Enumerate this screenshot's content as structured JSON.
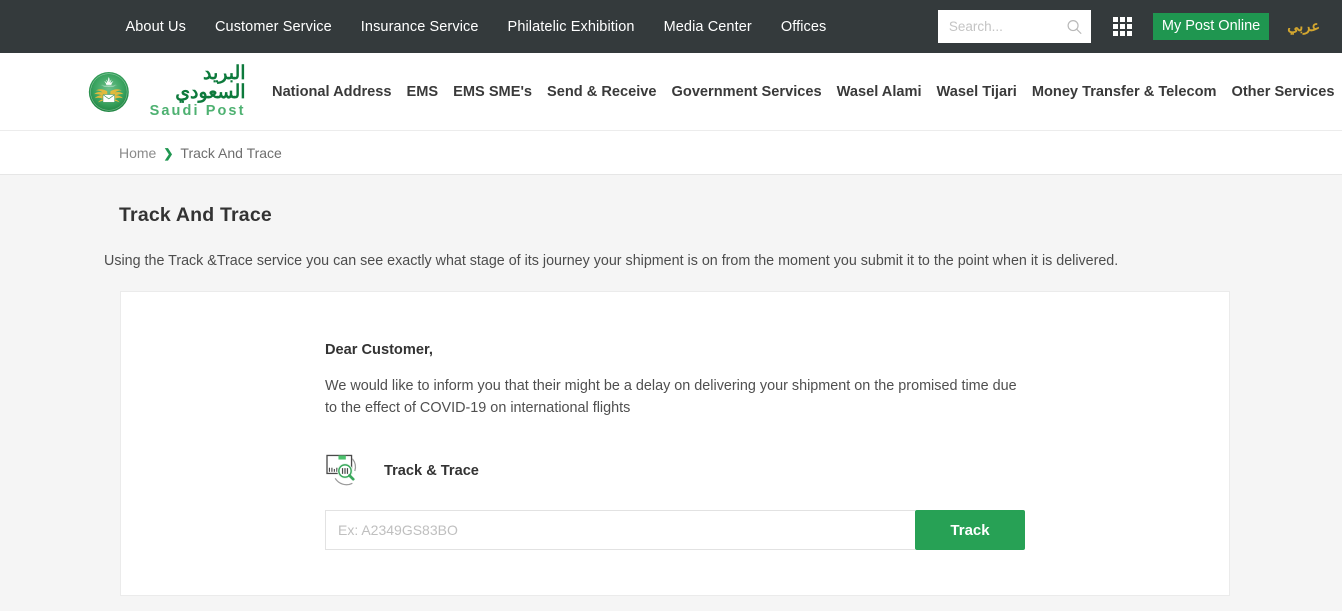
{
  "topbar": {
    "nav": [
      {
        "label": "About Us"
      },
      {
        "label": "Customer Service"
      },
      {
        "label": "Insurance Service"
      },
      {
        "label": "Philatelic Exhibition"
      },
      {
        "label": "Media Center"
      },
      {
        "label": "Offices"
      }
    ],
    "search": {
      "placeholder": "Search...",
      "value": "",
      "icon": "search-icon"
    },
    "apps_icon": "grid-apps-icon",
    "my_post_online": "My Post Online",
    "arabic_link": "عربي",
    "bg_color": "#343a3c",
    "accent_green": "#1f9650",
    "arabic_color": "#d3a62f"
  },
  "header": {
    "logo": {
      "arabic": "البريد السعودي",
      "english": "Saudi Post",
      "icon": "saudi-post-emblem-icon",
      "arabic_color": "#0d7a3c",
      "english_color": "#4eb171"
    },
    "nav": [
      {
        "label": "National Address"
      },
      {
        "label": "EMS"
      },
      {
        "label": "EMS SME's"
      },
      {
        "label": "Send & Receive"
      },
      {
        "label": "Government Services"
      },
      {
        "label": "Wasel Alami"
      },
      {
        "label": "Wasel Tijari"
      },
      {
        "label": "Money Transfer & Telecom"
      },
      {
        "label": "Other Services"
      }
    ]
  },
  "breadcrumb": {
    "home": "Home",
    "separator": "❯",
    "current": "Track And Trace"
  },
  "main": {
    "title": "Track And Trace",
    "description": "Using the Track &Trace service you can see exactly what stage of its journey your shipment is on from the moment you submit it to the point when it is delivered.",
    "card": {
      "salutation": "Dear Customer,",
      "notice": "We would like to inform you that their might be a delay on delivering your shipment on the promised time due to the effect of COVID-19 on international flights",
      "tracking_icon": "package-search-icon",
      "tracking_label": "Track & Trace",
      "input": {
        "placeholder": "Ex: A2349GS83BO",
        "value": ""
      },
      "button_label": "Track",
      "button_color": "#27a155"
    }
  }
}
